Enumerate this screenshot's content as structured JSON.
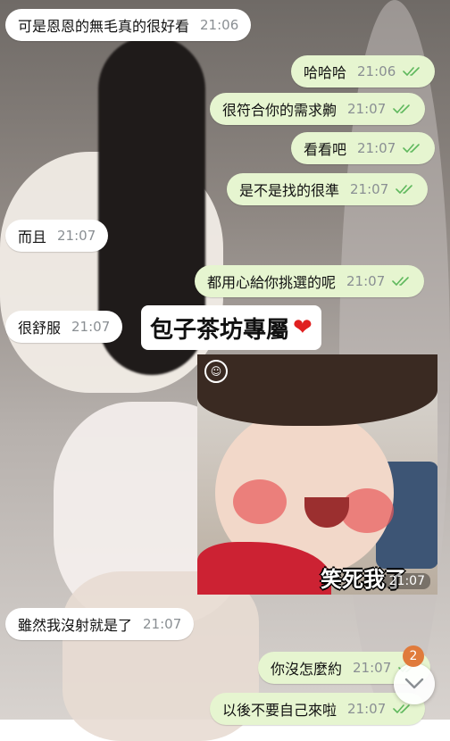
{
  "colors": {
    "incoming_bubble": "#ffffff",
    "outgoing_bubble": "#e6f5d0",
    "read_ticks": "#5fb85d",
    "unread_badge": "#e07b3c",
    "time_text": "#8a8f93"
  },
  "messages": [
    {
      "direction": "in",
      "text": "可是恩恩的無毛真的很好看",
      "time": "21:06"
    },
    {
      "direction": "out",
      "text": "哈哈哈",
      "time": "21:06",
      "status": "read"
    },
    {
      "direction": "out",
      "text": "很符合你的需求齁",
      "time": "21:07",
      "status": "read"
    },
    {
      "direction": "out",
      "text": "看看吧",
      "time": "21:07",
      "status": "read"
    },
    {
      "direction": "out",
      "text": "是不是找的很準",
      "time": "21:07",
      "status": "read"
    },
    {
      "direction": "in",
      "text": "而且",
      "time": "21:07"
    },
    {
      "direction": "out",
      "text": "都用心給你挑選的呢",
      "time": "21:07",
      "status": "read"
    },
    {
      "direction": "in",
      "text": "很舒服",
      "time": "21:07"
    },
    {
      "direction": "in",
      "text": "雖然我沒射就是了",
      "time": "21:07"
    },
    {
      "direction": "out",
      "text": "你沒怎麼約",
      "time": "21:07",
      "status": "read"
    },
    {
      "direction": "out",
      "text": "以後不要自己來啦",
      "time": "21:07",
      "status": "read"
    }
  ],
  "sticker": {
    "title": "包子茶坊專屬",
    "heart": "❤",
    "caption": "笑死我了",
    "time": "21:07",
    "icon": "smile-logo-icon"
  },
  "scroll_button": {
    "icon": "chevron-down-icon",
    "unread_count": "2"
  }
}
